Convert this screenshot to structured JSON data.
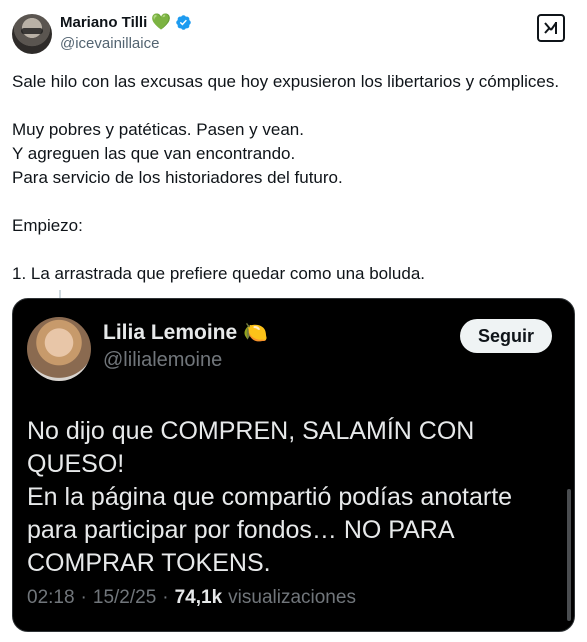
{
  "author": {
    "display_name": "Mariano Tilli",
    "heart_emoji": "💚",
    "handle": "@icevainillaice"
  },
  "tweet": {
    "text": "Sale hilo con las excusas que hoy expusieron los libertarios y cómplices.\n\nMuy pobres y patéticas. Pasen y vean.\nY agreguen las que van encontrando.\nPara servicio de los historiadores del futuro.\n\nEmpiezo:\n\n1. La arrastrada que prefiere quedar como una boluda."
  },
  "quoted_image": {
    "display_name": "Lilia Lemoine",
    "lemon_emoji": "🍋",
    "handle": "@lilialemoine",
    "follow_label": "Seguir",
    "text": "No dijo que COMPREN, SALAMÍN CON QUESO!\nEn la página que compartió podías anotarte para participar por fondos… NO PARA COMPRAR TOKENS.",
    "time": "02:18",
    "date": "15/2/25",
    "separator": "·",
    "views_count": "74,1k",
    "views_label": "visualizaciones"
  },
  "colors": {
    "verified": "#1d9bf0",
    "heart": "#78b159",
    "media_background": "#000000"
  },
  "icons": [
    "heart-icon",
    "verified-icon",
    "grok-icon",
    "lemon-icon"
  ]
}
